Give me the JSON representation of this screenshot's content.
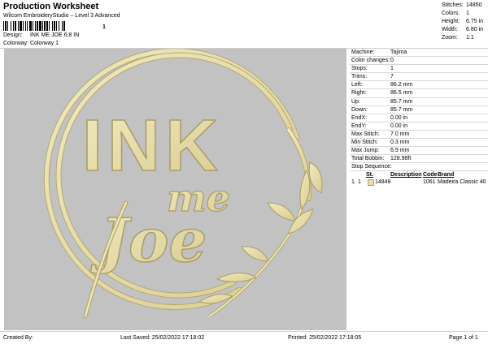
{
  "header": {
    "title": "Production Worksheet",
    "subtitle": "Wilcom EmbroideryStudio – Level 3 Advanced",
    "barcode_number": "1",
    "design_label": "Design:",
    "design_value": "INK ME JOE 6,8 IN",
    "colorway_label": "Colorway:",
    "colorway_value": "Colorway 1"
  },
  "stats": [
    {
      "label": "Stitches:",
      "value": "14850"
    },
    {
      "label": "Colors:",
      "value": "1"
    },
    {
      "label": "Height:",
      "value": "6.75 in"
    },
    {
      "label": "Width:",
      "value": "6.80 in"
    },
    {
      "label": "Zoom:",
      "value": "1:1"
    }
  ],
  "design": {
    "line1": "INK",
    "line2": "me",
    "line3": "Joe",
    "thread_color": "#e8dfa8",
    "thread_shadow": "#b8ac74",
    "background": "#c2c2c2"
  },
  "machine_info": [
    {
      "label": "Machine:",
      "value": "Tajima"
    },
    {
      "label": "Color changes:",
      "value": "0"
    },
    {
      "label": "Stops:",
      "value": "1"
    },
    {
      "label": "Trims:",
      "value": "7"
    },
    {
      "label": "Left:",
      "value": "86.2 mm"
    },
    {
      "label": "Right:",
      "value": "86.5 mm"
    },
    {
      "label": "Up:",
      "value": "85.7 mm"
    },
    {
      "label": "Down:",
      "value": "85.7 mm"
    },
    {
      "label": "EndX:",
      "value": "0.00 in"
    },
    {
      "label": "EndY:",
      "value": "0.00 in"
    },
    {
      "label": "Max Stitch:",
      "value": "7.0 mm"
    },
    {
      "label": "Min Stitch:",
      "value": "0.3 mm"
    },
    {
      "label": "Max Jump:",
      "value": "6.9 mm"
    },
    {
      "label": "Total Bobbin:",
      "value": "128.98ft"
    }
  ],
  "stop_sequence": {
    "heading": "Stop Sequence:",
    "headers": {
      "st": "St.",
      "description": "Description",
      "code": "Code",
      "brand": "Brand"
    },
    "rows": [
      {
        "index": "1.",
        "stop": "1",
        "stitches": "14848",
        "code": "1061",
        "brand": "Madeira Classic 40",
        "swatch": "#e9dfae"
      }
    ]
  },
  "footer": {
    "created_by": "Created By:",
    "last_saved": "Last Saved: 25/02/2022 17:18:02",
    "printed": "Printed: 25/02/2022 17:18:05",
    "page": "Page 1 of 1"
  }
}
